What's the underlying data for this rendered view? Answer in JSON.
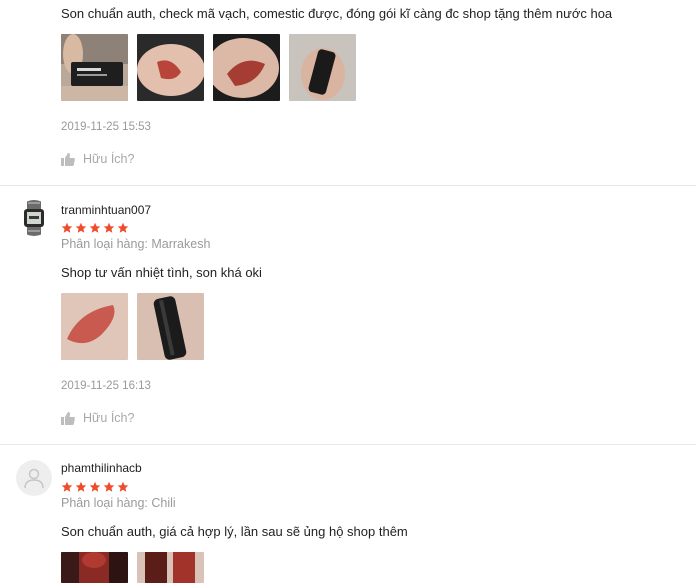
{
  "reviews": [
    {
      "content": "Son chuẩn auth, check mã vạch, comestic được, đóng gói kĩ càng đc shop tặng thêm nước hoa",
      "photos": [
        "box-in-hand-photo",
        "swatch-arm-photo",
        "swatch-closeup-photo",
        "lipstick-tube-photo"
      ],
      "timestamp": "2019-11-25 15:53",
      "helpful_label": "Hữu Ích?"
    },
    {
      "username": "tranminhtuan007",
      "rating": 5,
      "variation": "Phân loại hàng: Marrakesh",
      "content": "Shop tư vấn nhiệt tình, son khá oki",
      "photos": [
        "swatch-arm-photo",
        "lipstick-tube-photo"
      ],
      "timestamp": "2019-11-25 16:13",
      "helpful_label": "Hữu Ích?"
    },
    {
      "username": "phamthilinhacb",
      "rating": 5,
      "variation": "Phân loại hàng: Chili",
      "content": "Son chuẩn auth, giá cả hợp lý, lần sau sẽ ủng hộ shop thêm",
      "photos": [
        "lipstick-bullet-photo",
        "lipstick-bullet-photo"
      ]
    }
  ],
  "colors": {
    "star": "#ee4d2d",
    "muted": "#9a9a9a",
    "divider": "#e8e8e8"
  }
}
